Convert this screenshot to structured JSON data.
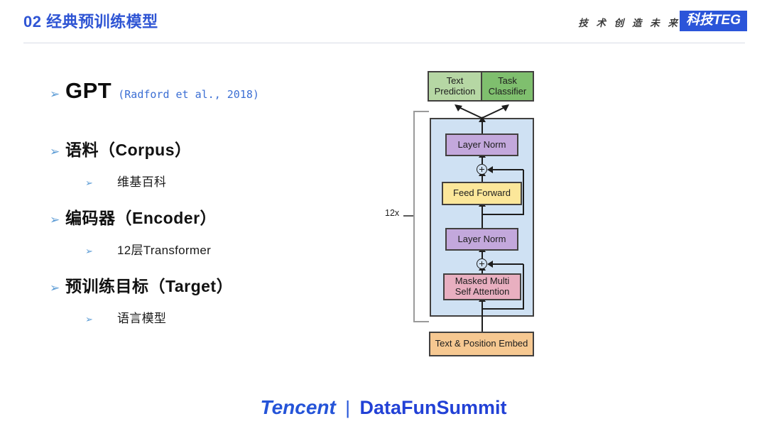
{
  "header": {
    "title": "02 经典预训练模型",
    "slogan": "技 术 创 造 未 来",
    "badge": "科技TEG",
    "accent_color": "#2f55d4",
    "badge_bg": "#2b55d9"
  },
  "bullets": [
    {
      "level": 1,
      "icon": "arrowhead-bullet-icon",
      "name": "GPT",
      "citation": "(Radford et al., 2018)",
      "citation_color": "#3c6fd4"
    },
    {
      "level": 1,
      "icon": "arrowhead-bullet-icon",
      "text": "语料（Corpus）"
    },
    {
      "level": 2,
      "icon": "arrowhead-bullet-icon",
      "text": "维基百科"
    },
    {
      "level": 1,
      "icon": "arrowhead-bullet-icon",
      "text": "编码器（Encoder）"
    },
    {
      "level": 2,
      "icon": "arrowhead-bullet-icon",
      "text": "12层Transformer"
    },
    {
      "level": 1,
      "icon": "arrowhead-bullet-icon",
      "text": "预训练目标（Target）"
    },
    {
      "level": 2,
      "icon": "arrowhead-bullet-icon",
      "text": "语言模型"
    }
  ],
  "bullet_glyph": "➢",
  "diagram": {
    "name": "gpt-transformer-architecture-diagram",
    "repeat_label": "12x",
    "plus_glyph": "⊕",
    "boxes": {
      "text_prediction": {
        "label": "Text Prediction",
        "line1": "Text",
        "line2": "Prediction",
        "color": "#b6d7a4"
      },
      "task_classifier": {
        "label": "Task Classifier",
        "line1": "Task",
        "line2": "Classifier",
        "color": "#7fbf6e"
      },
      "layer_norm_top": {
        "label": "Layer Norm",
        "color": "#c3a8dc"
      },
      "feed_forward": {
        "label": "Feed Forward",
        "color": "#fce79a"
      },
      "layer_norm_bottom": {
        "label": "Layer Norm",
        "color": "#c3a8dc"
      },
      "masked_attention": {
        "label": "Masked Multi Self Attention",
        "line1": "Masked Multi",
        "line2": "Self Attention",
        "color": "#e8afc0"
      },
      "text_position_embed": {
        "label": "Text & Position Embed",
        "color": "#f6c891"
      },
      "transformer_block": {
        "color": "#cfe1f3"
      }
    }
  },
  "footer": {
    "tencent": "Tencent",
    "separator": "|",
    "datafun": "DataFunSummit",
    "color": "#2554d8"
  }
}
